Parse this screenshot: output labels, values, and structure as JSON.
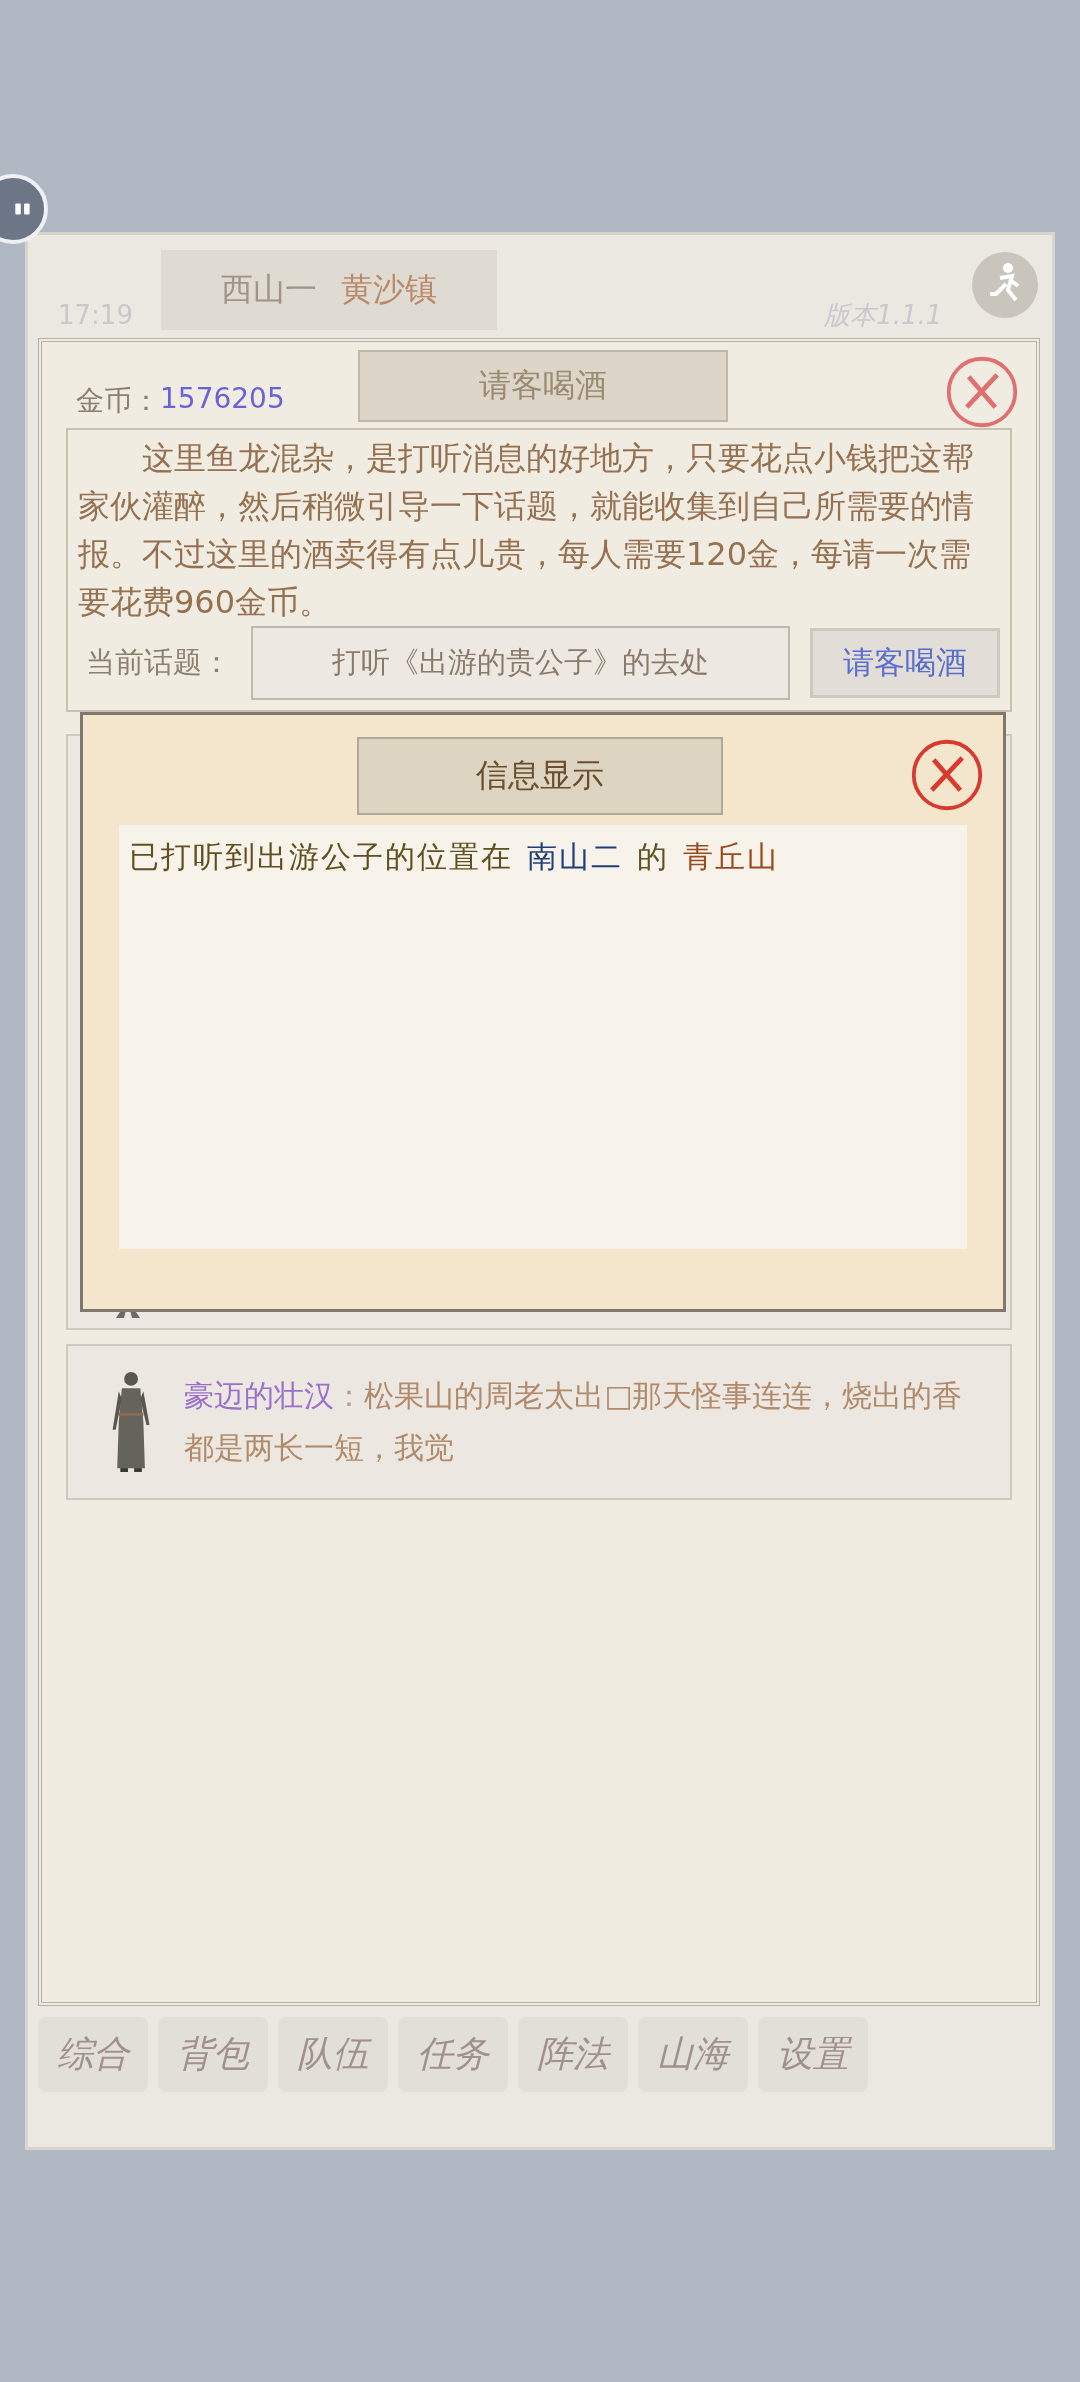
{
  "status": {
    "time": "17:19",
    "version": "版本1.1.1"
  },
  "location": {
    "region": "西山一",
    "town": "黄沙镇"
  },
  "dialog": {
    "title": "请客喝酒",
    "gold_label": "金币：",
    "gold": "1576205",
    "description": "这里鱼龙混杂，是打听消息的好地方，只要花点小钱把这帮家伙灌醉，然后稍微引导一下话题，就能收集到自己所需要的情报。不过这里的酒卖得有点儿贵，每人需要120金，每请一次需要花费960金币。",
    "topic_label": "当前话题：",
    "topic": "打听《出游的贵公子》的去处",
    "action": "请客喝酒"
  },
  "rumors": [
    {
      "speaker": "豪迈的壮汉",
      "separator": "：",
      "text": "松果山的周老太出□那天怪事连连，烧出的香都是两长一短，我觉"
    }
  ],
  "info": {
    "title": "信息显示",
    "message": [
      {
        "text": "已打听到出游公子的位置在",
        "color": "#5e5020"
      },
      {
        "text": "南山二",
        "color": "#1f3f7a"
      },
      {
        "text": "的",
        "color": "#5e5020"
      },
      {
        "text": "青丘山",
        "color": "#9a4a1c"
      }
    ]
  },
  "tabs": [
    {
      "label": "综合"
    },
    {
      "label": "背包"
    },
    {
      "label": "队伍"
    },
    {
      "label": "任务"
    },
    {
      "label": "阵法"
    },
    {
      "label": "山海"
    },
    {
      "label": "设置"
    }
  ]
}
